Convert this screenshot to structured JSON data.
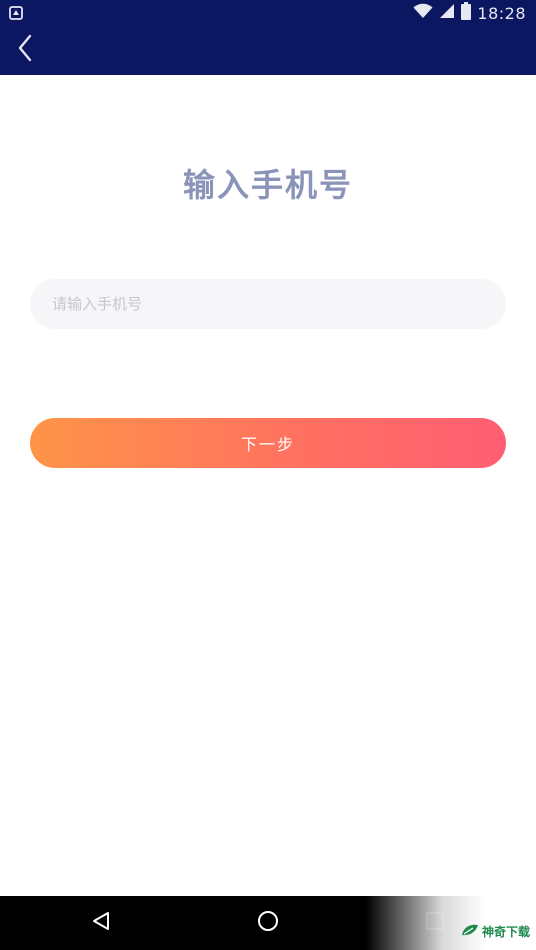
{
  "status_bar": {
    "time": "18:28"
  },
  "page": {
    "title": "输入手机号"
  },
  "phone_input": {
    "value": "",
    "placeholder": "请输入手机号"
  },
  "next_button": {
    "label": "下一步"
  },
  "colors": {
    "header_bg": "#0b1760",
    "title": "#8a93b8",
    "button_gradient_start": "#ff9448",
    "button_gradient_end": "#ff5e73",
    "input_bg": "#f6f6f8"
  },
  "icons": {
    "back": "chevron-left-icon",
    "wifi": "wifi-icon",
    "signal": "signal-icon",
    "battery": "battery-icon",
    "nav_back": "triangle-back-icon",
    "nav_home": "circle-home-icon",
    "nav_recent": "square-recent-icon"
  },
  "watermark": {
    "text": "神奇下载"
  }
}
